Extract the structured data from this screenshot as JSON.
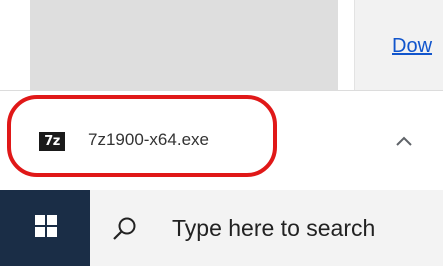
{
  "page": {
    "link_text": "Dow"
  },
  "download_shelf": {
    "file_icon_text": "7z",
    "file_name": "7z1900-x64.exe",
    "expand_icon": "chevron-up-icon"
  },
  "taskbar": {
    "start_icon": "windows-logo-icon",
    "search_icon": "search-icon",
    "search_placeholder": "Type here to search"
  },
  "colors": {
    "highlight": "#e01818",
    "taskbar": "#1a2d46",
    "link": "#1155cc"
  }
}
